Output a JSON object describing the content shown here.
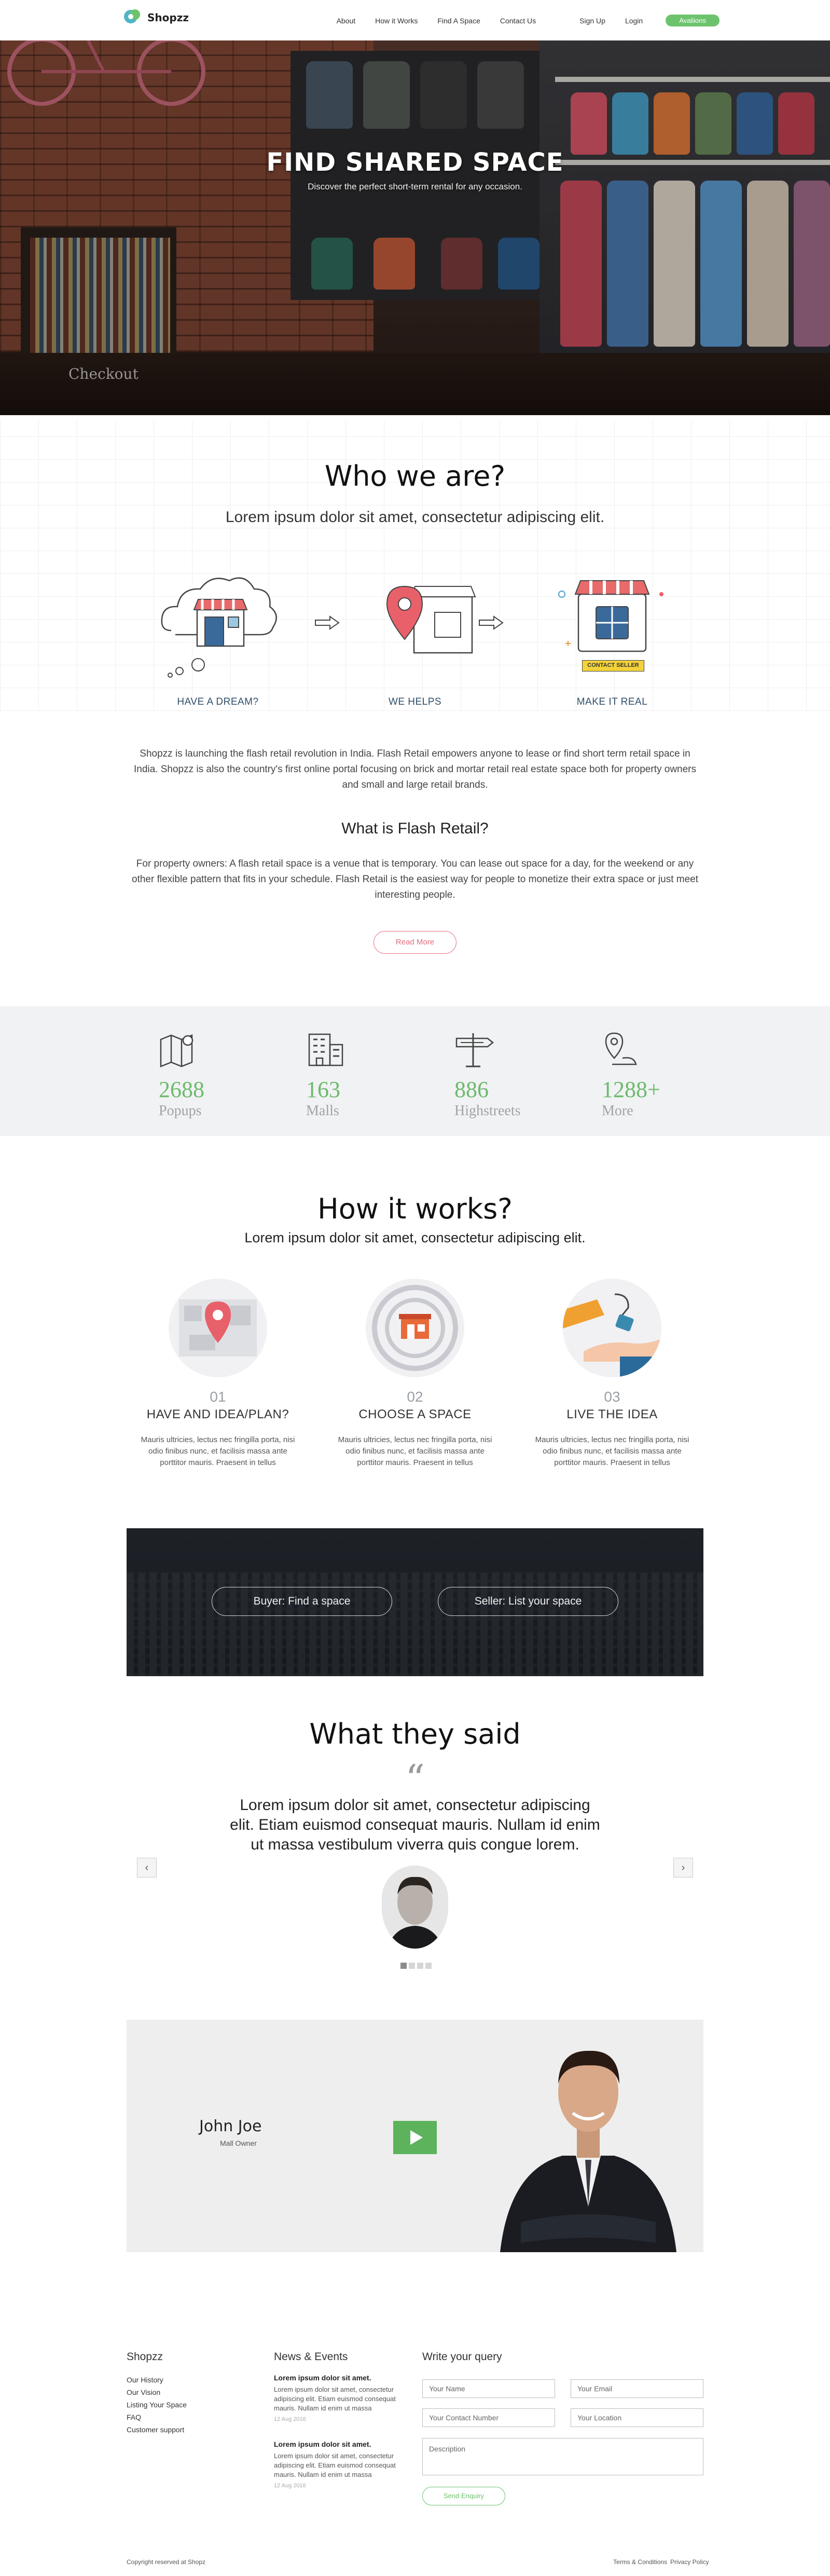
{
  "nav": {
    "brand": "Shopzz",
    "links": [
      "About",
      "How it Works",
      "Find A Space",
      "Contact Us",
      "Sign Up",
      "Login"
    ],
    "cta": "Avaliions"
  },
  "hero": {
    "title": "FIND SHARED SPACE",
    "subtitle": "Discover the perfect short-term rental for any occasion.",
    "sign": "Checkout"
  },
  "about": {
    "heading": "Who we are?",
    "lead": "Lorem ipsum dolor sit amet, consectetur adipiscing elit.",
    "steps": [
      "HAVE A DREAM?",
      "WE HELPS",
      "MAKE IT REAL"
    ],
    "contact_tag": "CONTACT SELLER",
    "paragraph": "Shopzz is launching the flash retail revolution in India. Flash Retail empowers anyone to lease or find short term retail space in India. Shopzz is also the country's first online portal focusing on brick and mortar retail real estate space both for property owners and small and large retail brands.",
    "subheading": "What is Flash Retail?",
    "paragraph2": "For property owners: A flash retail space is a venue that is temporary. You can lease out space for a day, for the weekend or any other flexible pattern that fits in your schedule. Flash Retail is the easiest way for people to monetize their extra space or just meet interesting people.",
    "read_more": "Read More"
  },
  "stats": [
    {
      "value": "2688",
      "label": "Popups",
      "icon": "map-icon"
    },
    {
      "value": "163",
      "label": "Malls",
      "icon": "building-icon"
    },
    {
      "value": "886",
      "label": "Highstreets",
      "icon": "signpost-icon"
    },
    {
      "value": "1288+",
      "label": "More",
      "icon": "location-icon"
    }
  ],
  "how": {
    "heading": "How it works?",
    "lead": "Lorem ipsum dolor sit amet, consectetur adipiscing elit.",
    "items": [
      {
        "num": "01",
        "title": "HAVE AND IDEA/PLAN?",
        "text": "Mauris ultricies, lectus nec fringilla porta, nisi odio finibus nunc, et facilisis massa ante porttitor mauris. Praesent in tellus"
      },
      {
        "num": "02",
        "title": "CHOOSE A SPACE",
        "text": "Mauris ultricies, lectus nec fringilla porta, nisi odio finibus nunc, et facilisis massa ante porttitor mauris. Praesent in tellus"
      },
      {
        "num": "03",
        "title": "LIVE THE IDEA",
        "text": "Mauris ultricies, lectus nec fringilla porta, nisi odio finibus nunc, et facilisis massa ante porttitor mauris. Praesent in tellus"
      }
    ]
  },
  "cta": {
    "buyer": "Buyer: Find a space",
    "seller": "Seller: List your space"
  },
  "testimonials": {
    "heading": "What they said",
    "quote": "Lorem ipsum dolor sit amet, consectetur adipiscing elit. Etiam euismod consequat mauris. Nullam id enim ut massa vestibulum viverra quis congue lorem.",
    "prev": "‹",
    "next": "›"
  },
  "video": {
    "name": "John Joe",
    "role": "Mall Owner"
  },
  "footer": {
    "col1_title": "Shopzz",
    "links": [
      "Our History",
      "Our Vision",
      "Listing Your Space",
      "FAQ",
      "Customer support"
    ],
    "col2_title": "News & Events",
    "news": [
      {
        "title": "Lorem ipsum dolor sit amet.",
        "body": "Lorem ipsum dolor sit amet, consectetur adipiscing elit. Etiam euismod consequat mauris. Nullam id enim ut massa",
        "date": "12 Aug 2016"
      },
      {
        "title": "Lorem ipsum dolor sit amet.",
        "body": "Lorem ipsum dolor sit amet, consectetur adipiscing elit. Etiam euismod consequat mauris. Nullam id enim ut massa",
        "date": "12 Aug 2016"
      }
    ],
    "col3_title": "Write your query",
    "form": {
      "name": "Your Name",
      "email": "Your Email",
      "phone": "Your Contact Number",
      "location": "Your Location",
      "description": "Description",
      "submit": "Send Enquiry"
    },
    "copyright": "Copyright reserved at Shopz",
    "terms": "Terms & Conditions",
    "privacy": "Privacy Policy"
  },
  "colors": {
    "accent_green": "#6cc36c",
    "accent_pink": "#e56b7a",
    "stat_green": "#6cba6c",
    "step_label": "#2f4e6a"
  }
}
